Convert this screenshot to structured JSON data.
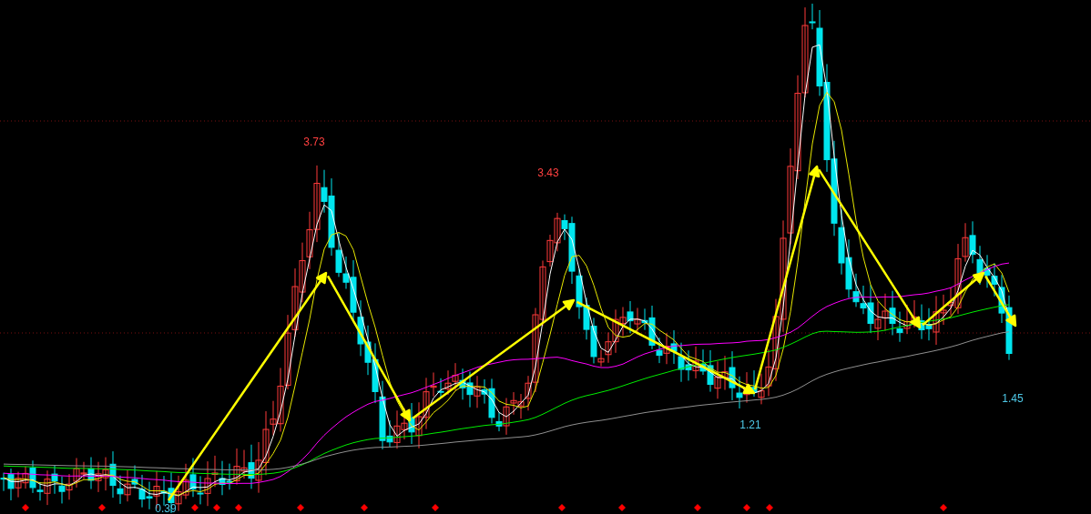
{
  "chart": {
    "price_labels": [
      {
        "text": "3.73",
        "kind": "high"
      },
      {
        "text": "3.43",
        "kind": "high"
      },
      {
        "text": "1.21",
        "kind": "low"
      },
      {
        "text": "1.45",
        "kind": "low"
      },
      {
        "text": "0.39",
        "kind": "low"
      }
    ]
  }
}
